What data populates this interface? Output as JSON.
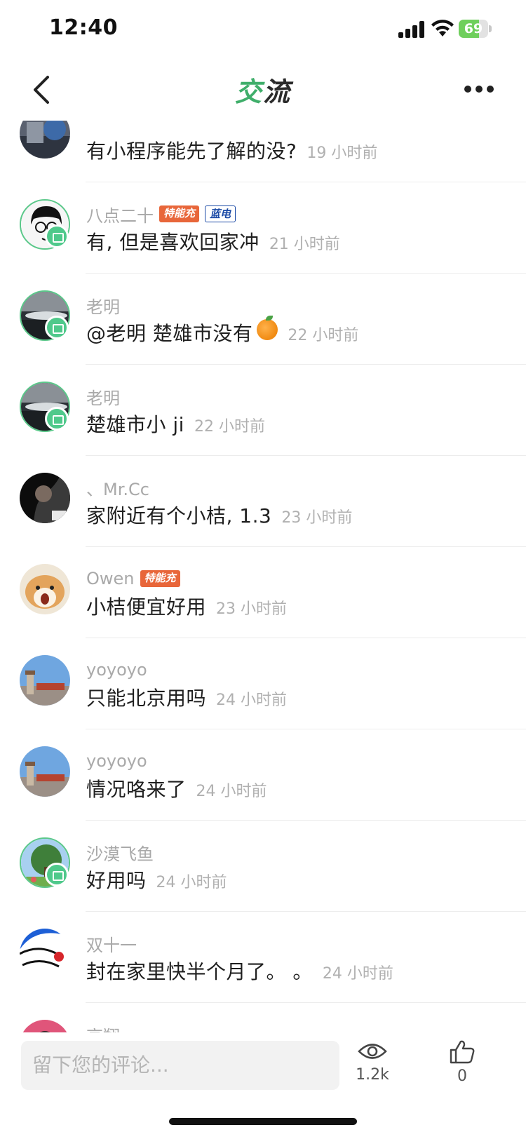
{
  "status_bar": {
    "time": "12:40",
    "battery": "69",
    "battery_level": 0.69
  },
  "nav": {
    "title_accent": "交",
    "title_rest": "流"
  },
  "comments": [
    {
      "name": "",
      "tags": [],
      "text": "有小程序能先了解的没?",
      "time": "19 小时前",
      "avatar": "car-photo",
      "badge": false
    },
    {
      "name": "八点二十",
      "tags": [
        {
          "label": "特能充",
          "style": "orange"
        },
        {
          "label": "蓝电",
          "style": "blue"
        }
      ],
      "text": "有, 但是喜欢回家冲",
      "time": "21 小时前",
      "avatar": "cartoon-boy",
      "badge": true
    },
    {
      "name": "老明",
      "tags": [],
      "text": "@老明  楚雄市没有",
      "emoji": "orange-emoji",
      "time": "22 小时前",
      "avatar": "sea-photo",
      "badge": true
    },
    {
      "name": "老明",
      "tags": [],
      "text": "楚雄市小 ji",
      "time": "22 小时前",
      "avatar": "sea-photo",
      "badge": true
    },
    {
      "name": "、Mr.Cc",
      "tags": [],
      "text": "家附近有个小桔, 1.3",
      "time": "23 小时前",
      "avatar": "dark-portrait",
      "badge": false
    },
    {
      "name": "Owen",
      "tags": [
        {
          "label": "特能充",
          "style": "orange"
        }
      ],
      "text": "小桔便宜好用",
      "time": "23 小时前",
      "avatar": "shiba-dog",
      "badge": false
    },
    {
      "name": "yoyoyo",
      "tags": [],
      "text": "只能北京用吗",
      "time": "24 小时前",
      "avatar": "tower-sky",
      "badge": false
    },
    {
      "name": "yoyoyo",
      "tags": [],
      "text": "情况咯来了",
      "time": "24 小时前",
      "avatar": "tower-sky",
      "badge": false
    },
    {
      "name": "沙漠飞鱼",
      "tags": [],
      "text": "好用吗",
      "time": "24 小时前",
      "avatar": "tree-photo",
      "badge": true
    },
    {
      "name": "双十一",
      "tags": [],
      "text": "封在家里快半个月了。 。",
      "time": "24 小时前",
      "avatar": "doraemon",
      "badge": false
    },
    {
      "name": "高翔",
      "tags": [],
      "text": "",
      "time": "",
      "avatar": "pink-avatar",
      "badge": false
    }
  ],
  "bottom": {
    "input_placeholder": "留下您的评论...",
    "views": "1.2k",
    "likes": "0"
  },
  "colors": {
    "accent_green": "#3fae6a",
    "tag_orange": "#e8663a",
    "tag_blue": "#1b4aa6"
  }
}
